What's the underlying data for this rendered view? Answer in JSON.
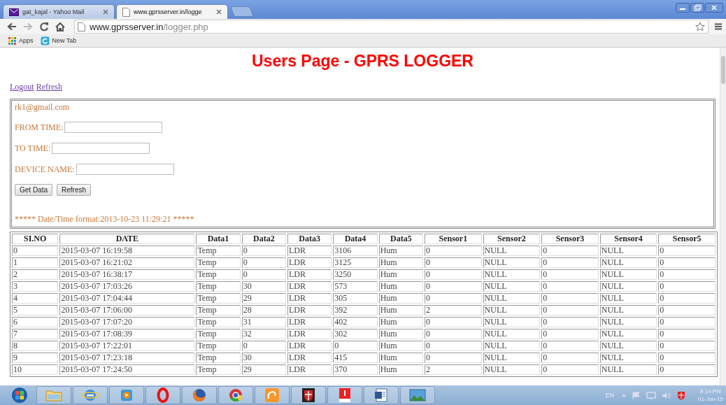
{
  "browser": {
    "tabs": [
      {
        "title": "gat_kajal - Yahoo Mail",
        "kind": "mail",
        "selected": false
      },
      {
        "title": "www.gprsserver.in/logge",
        "kind": "page",
        "selected": true
      }
    ],
    "address": {
      "host": "www.gprsserver.in",
      "path": "/logger.php"
    },
    "bookmarks": [
      {
        "label": "Apps",
        "kind": "apps"
      },
      {
        "label": "New Tab",
        "kind": "newtab"
      }
    ]
  },
  "page": {
    "title": "Users Page - GPRS LOGGER",
    "links": [
      "Logout",
      "Refresh"
    ],
    "form": {
      "email": "rk1@gmail.com",
      "fields": [
        {
          "label": "FROM TIME:"
        },
        {
          "label": "TO TIME:"
        },
        {
          "label": "DEVICE NAME:"
        }
      ],
      "buttons": [
        "Get Data",
        "Refresh"
      ],
      "note": "***** Date/Time format:2013-10-23 11:29:21 *****"
    },
    "table": {
      "columns": [
        "SI.NO",
        "DATE",
        "Data1",
        "Data2",
        "Data3",
        "Data4",
        "Data5",
        "Sensor1",
        "Sensor2",
        "Sensor3",
        "Sensor4",
        "Sensor5"
      ],
      "rows": [
        [
          "0",
          "2015-03-07 16:19:58",
          "Temp",
          "0",
          "LDR",
          "3106",
          "Hum",
          "0",
          "NULL",
          "0",
          "NULL",
          "0"
        ],
        [
          "1",
          "2015-03-07 16:21:02",
          "Temp",
          "0",
          "LDR",
          "3125",
          "Hum",
          "0",
          "NULL",
          "0",
          "NULL",
          "0"
        ],
        [
          "2",
          "2015-03-07 16:38:17",
          "Temp",
          "0",
          "LDR",
          "3250",
          "Hum",
          "0",
          "NULL",
          "0",
          "NULL",
          "0"
        ],
        [
          "3",
          "2015-03-07 17:03:26",
          "Temp",
          "30",
          "LDR",
          "573",
          "Hum",
          "0",
          "NULL",
          "0",
          "NULL",
          "0"
        ],
        [
          "4",
          "2015-03-07 17:04:44",
          "Temp",
          "29",
          "LDR",
          "305",
          "Hum",
          "0",
          "NULL",
          "0",
          "NULL",
          "0"
        ],
        [
          "5",
          "2015-03-07 17:06:00",
          "Temp",
          "28",
          "LDR",
          "392",
          "Hum",
          "2",
          "NULL",
          "0",
          "NULL",
          "0"
        ],
        [
          "6",
          "2015-03-07 17:07:20",
          "Temp",
          "31",
          "LDR",
          "402",
          "Hum",
          "0",
          "NULL",
          "0",
          "NULL",
          "0"
        ],
        [
          "7",
          "2015-03-07 17:08:39",
          "Temp",
          "32",
          "LDR",
          "302",
          "Hum",
          "0",
          "NULL",
          "0",
          "NULL",
          "0"
        ],
        [
          "8",
          "2015-03-07 17:22:01",
          "Temp",
          "0",
          "LDR",
          "0",
          "Hum",
          "0",
          "NULL",
          "0",
          "NULL",
          "0"
        ],
        [
          "9",
          "2015-03-07 17:23:18",
          "Temp",
          "30",
          "LDR",
          "415",
          "Hum",
          "0",
          "NULL",
          "0",
          "NULL",
          "0"
        ],
        [
          "10",
          "2015-03-07 17:24:50",
          "Temp",
          "29",
          "LDR",
          "370",
          "Hum",
          "2",
          "NULL",
          "0",
          "NULL",
          "0"
        ]
      ]
    }
  },
  "taskbar": {
    "language": "EN",
    "time": "8:14 PM",
    "date": "01-Jun-15"
  }
}
